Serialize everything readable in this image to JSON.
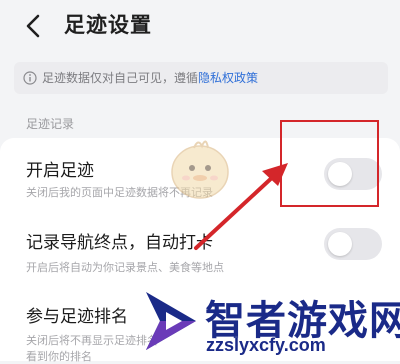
{
  "header": {
    "title": "足迹设置",
    "back_icon": "chevron-left-icon"
  },
  "notice": {
    "icon": "info-icon",
    "text": "足迹数据仅对自己可见，遵循",
    "link_label": "隐私权政策"
  },
  "section": {
    "title": "足迹记录"
  },
  "settings": [
    {
      "title": "开启足迹",
      "description": "关闭后我的页面中足迹数据将不再记录",
      "enabled": false
    },
    {
      "title": "记录导航终点，自动打卡",
      "description": "开启后将自动为你记录景点、美食等地点",
      "enabled": false
    },
    {
      "title": "参与足迹排名",
      "description": "关闭后将不再显示足迹排名",
      "description_line2": "看到你的排名",
      "enabled": false
    }
  ],
  "watermark": {
    "brand": "智者游戏网",
    "url": "zzslyxcfy.com"
  },
  "colors": {
    "background": "#f3f4f6",
    "link": "#2f6fd8",
    "toggle_off": "#e6e6ea",
    "highlight": "#d4262a",
    "watermark": "#1a2a88"
  }
}
